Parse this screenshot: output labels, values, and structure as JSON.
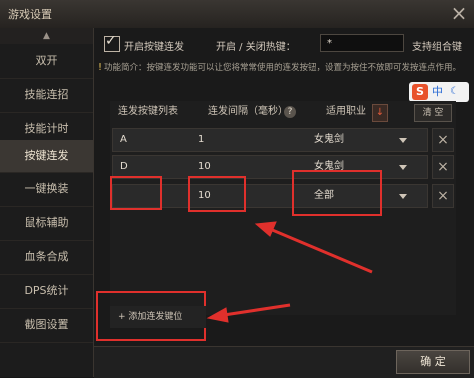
{
  "window": {
    "title": "游戏设置",
    "close_label": "×"
  },
  "sidebar": {
    "scroll_up": "▲",
    "items": [
      {
        "label": "双开"
      },
      {
        "label": "技能连招"
      },
      {
        "label": "技能计时"
      },
      {
        "label": "按键连发"
      },
      {
        "label": "一键换装"
      },
      {
        "label": "鼠标辅助"
      },
      {
        "label": "血条合成"
      },
      {
        "label": "DPS统计"
      },
      {
        "label": "截图设置"
      }
    ]
  },
  "settings": {
    "enable_checkbox_label": "开启按键连发",
    "enable_checked": true,
    "hotkey_label": "开启 / 关闭热键：",
    "hotkey_value": "*",
    "hotkey_combo_label": "支持组合键",
    "description": "功能简介：按键连发功能可以让您将常常使用的连发按钮，设置为按住不放即可发按连点作用。"
  },
  "table": {
    "headers": {
      "keys": "连发按键列表",
      "interval": "连发间隔（毫秒）",
      "profession": "适用职业"
    },
    "help_icon": "?",
    "sort_icon": "↓",
    "clear_label": "清 空",
    "rows": [
      {
        "key": "A",
        "interval": "1",
        "profession": "女鬼剑"
      },
      {
        "key": "D",
        "interval": "10",
        "profession": "女鬼剑"
      },
      {
        "key": "",
        "interval": "10",
        "profession": "全部"
      }
    ],
    "add_label": "+ 添加连发键位"
  },
  "ime": {
    "logo": "S",
    "mode": "中",
    "moon": "☾"
  },
  "footer": {
    "ok_label": "确 定"
  },
  "colors": {
    "highlight": "#e0302c",
    "active_sidebar": "#3b3733"
  }
}
